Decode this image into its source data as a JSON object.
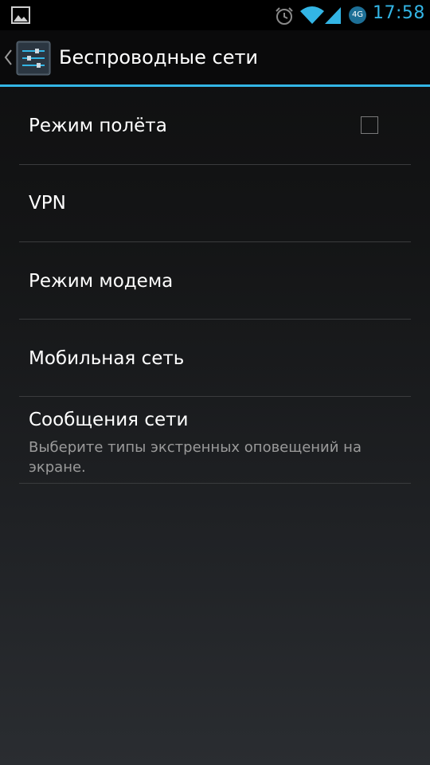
{
  "status_bar": {
    "time": "17:58",
    "network_type": "4G",
    "icons": [
      "gallery-icon",
      "alarm-icon",
      "wifi-icon",
      "signal-icon",
      "network-type-icon"
    ],
    "accent_color": "#33b5e5"
  },
  "action_bar": {
    "title": "Беспроводные сети",
    "up_icon": "chevron-left-icon",
    "app_icon": "settings-sliders-icon",
    "divider_color": "#33b5e5"
  },
  "preferences": [
    {
      "title": "Режим полёта",
      "has_checkbox": true,
      "checked": false
    },
    {
      "title": "VPN"
    },
    {
      "title": "Режим модема"
    },
    {
      "title": "Мобильная сеть"
    },
    {
      "title": "Сообщения сети",
      "summary": "Выберите типы экстренных оповещений на экране."
    }
  ]
}
